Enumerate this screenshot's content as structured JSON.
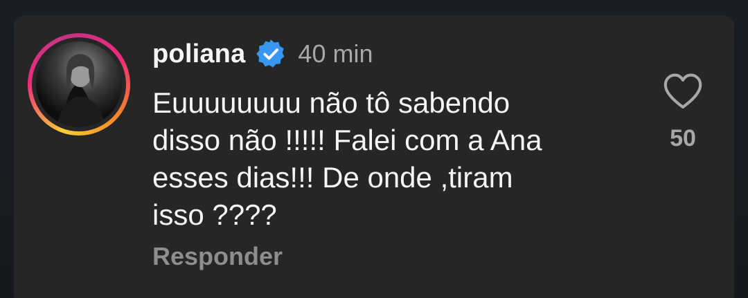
{
  "comment": {
    "username": "poliana",
    "verified": true,
    "time": "40 min",
    "text": "Euuuuuuuu não tô sabendo\ndisso não !!!!! Falei com a Ana\nesses dias!!! De onde ,tiram\nisso ????",
    "reply_label": "Responder",
    "like_count": "50"
  },
  "icons": {
    "verified": "verified-badge-icon",
    "like": "heart-outline-icon"
  },
  "colors": {
    "background": "#262626",
    "text": "#f5f5f5",
    "muted": "#a8a8a8",
    "verified_blue": "#3897f0",
    "ring_start": "#f9ce34",
    "ring_mid": "#ee2a7b"
  }
}
